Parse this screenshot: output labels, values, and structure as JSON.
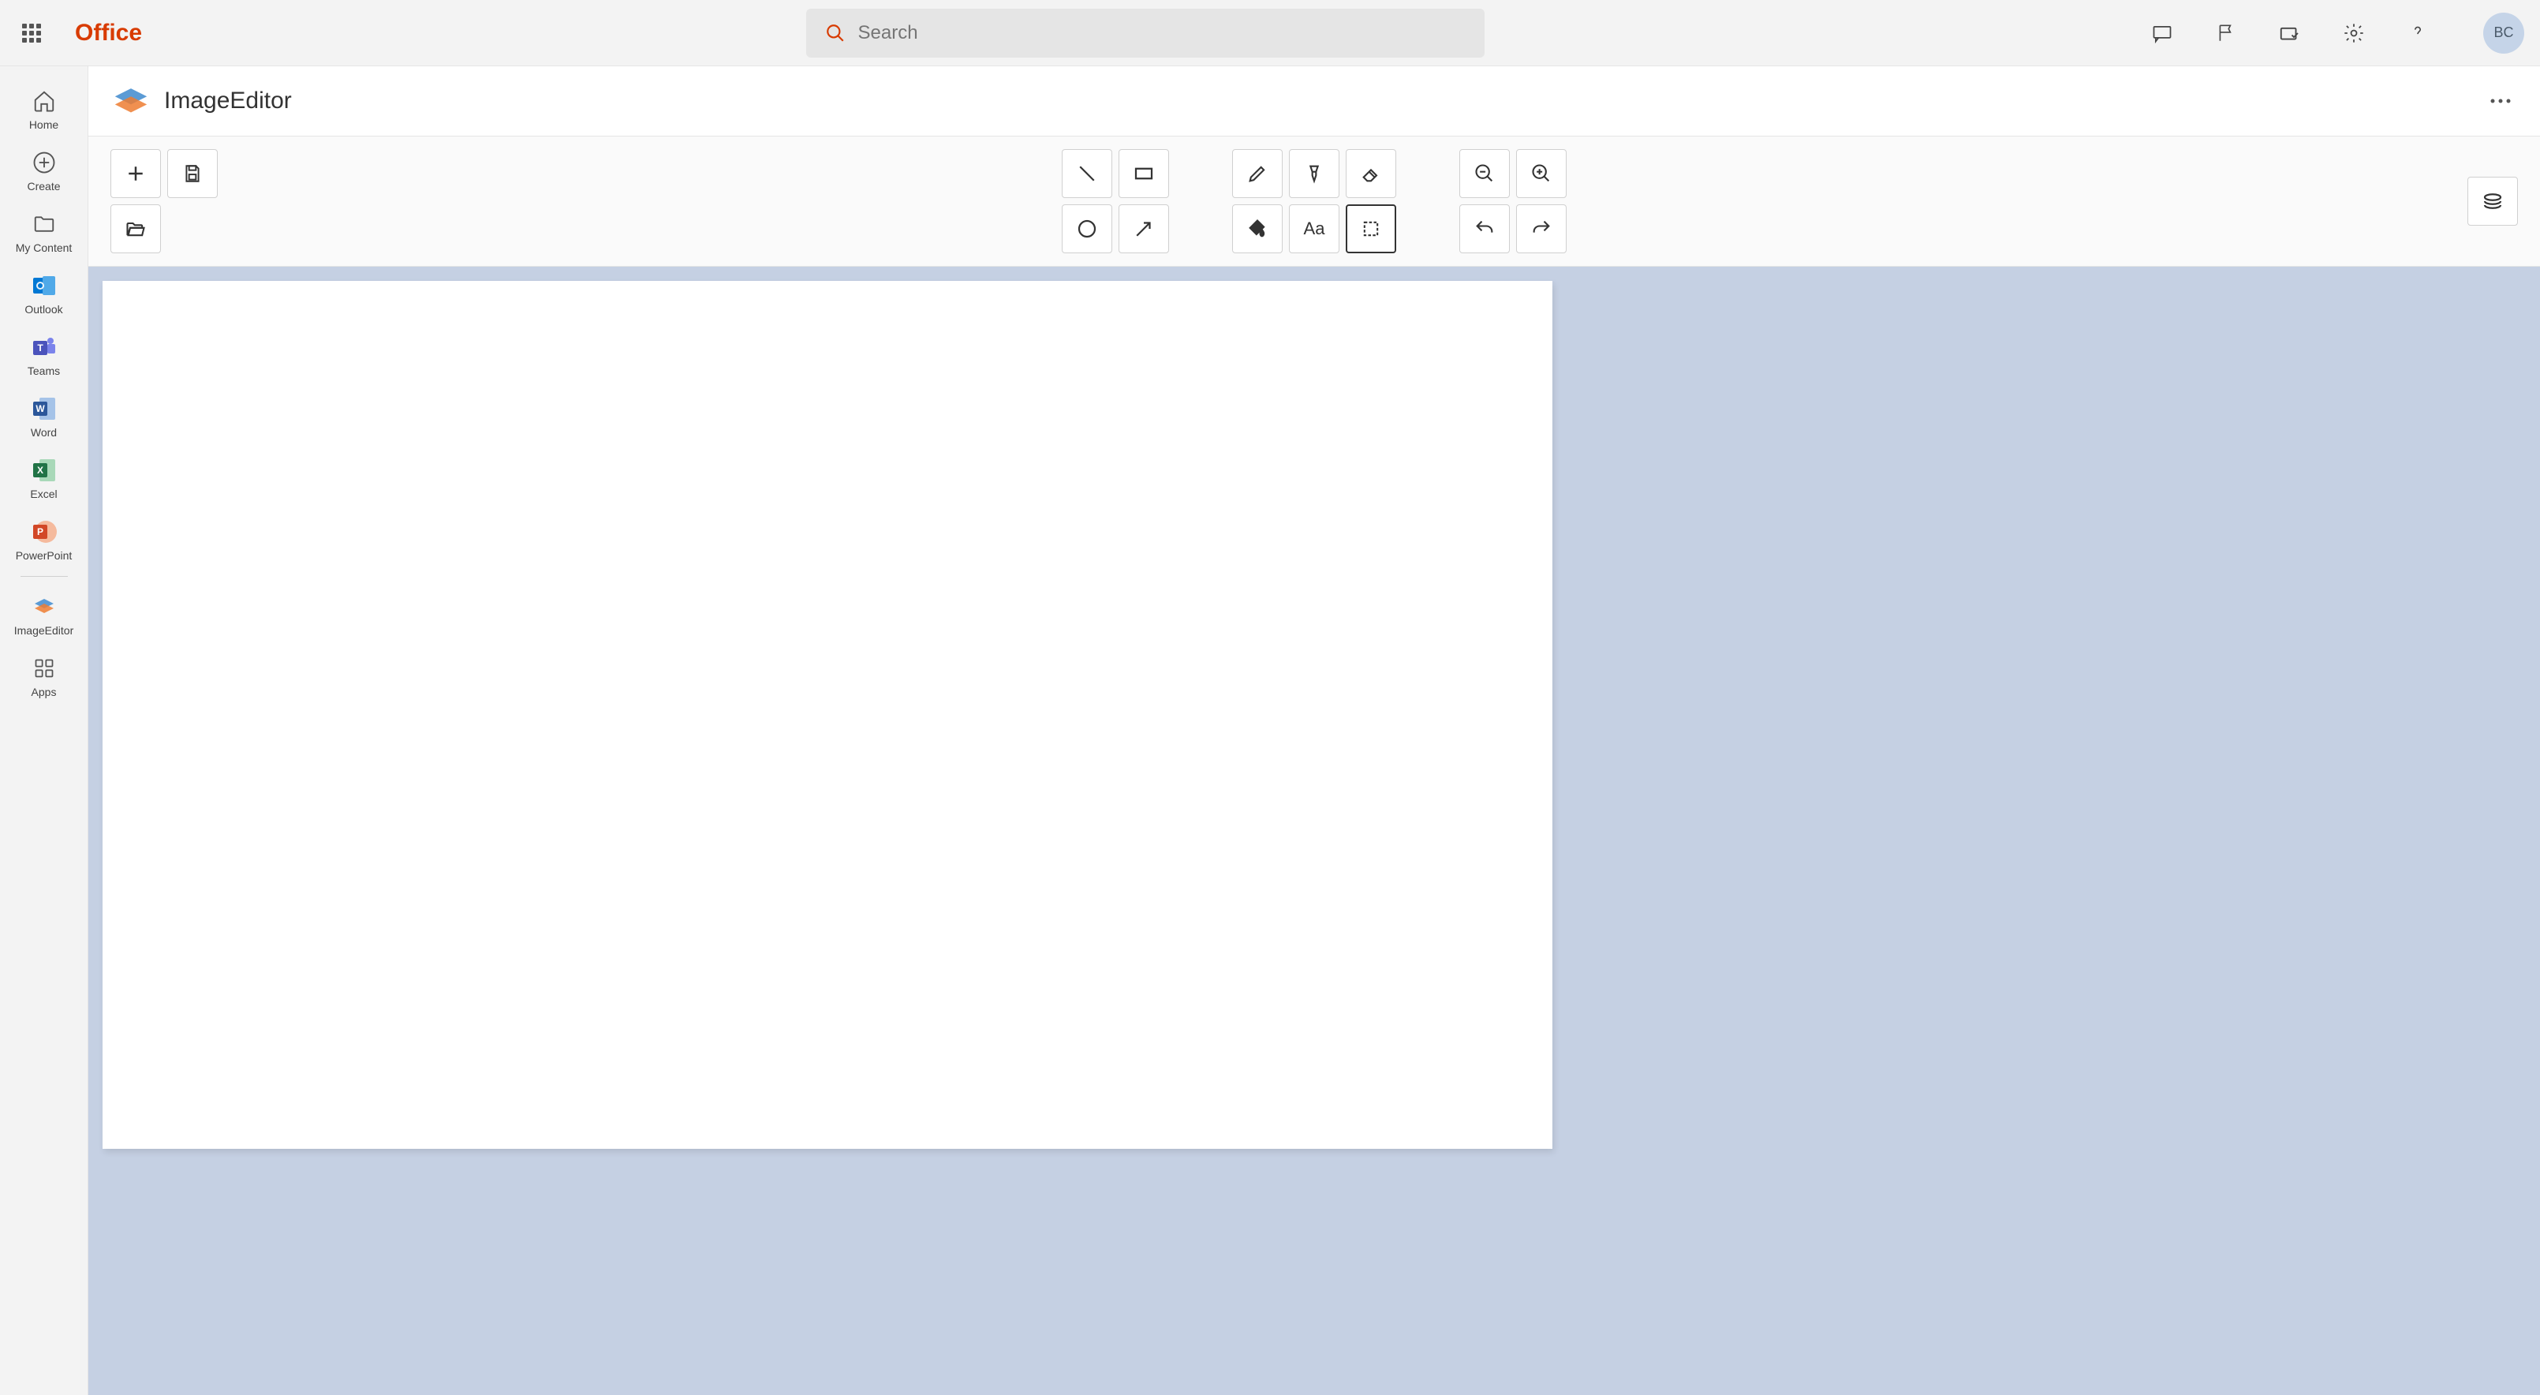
{
  "header": {
    "brand": "Office",
    "search_placeholder": "Search",
    "user_initials": "BC"
  },
  "sidebar": {
    "items": [
      {
        "label": "Home"
      },
      {
        "label": "Create"
      },
      {
        "label": "My Content"
      },
      {
        "label": "Outlook"
      },
      {
        "label": "Teams"
      },
      {
        "label": "Word"
      },
      {
        "label": "Excel"
      },
      {
        "label": "PowerPoint"
      },
      {
        "label": "ImageEditor"
      },
      {
        "label": "Apps"
      }
    ]
  },
  "app": {
    "title": "ImageEditor"
  },
  "toolbar": {
    "file_ops": [
      "new",
      "save",
      "open"
    ],
    "shapes": [
      "line",
      "rectangle",
      "ellipse",
      "arrow"
    ],
    "draw": [
      "pencil",
      "brush",
      "eraser",
      "fill",
      "text",
      "select"
    ],
    "view": [
      "zoom-out",
      "zoom-in",
      "undo",
      "redo"
    ],
    "right": [
      "stack"
    ]
  }
}
